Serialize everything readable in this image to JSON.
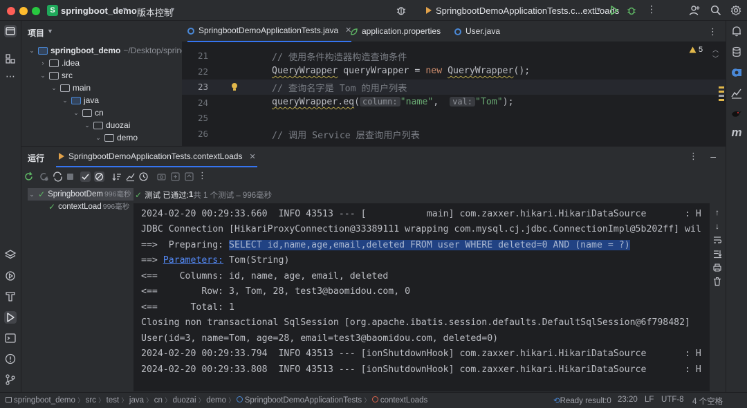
{
  "titlebar": {
    "project_badge": "S",
    "project_name": "springboot_demo",
    "vcs_label": "版本控制",
    "run_config": "SpringbootDemoApplicationTests.c...extLoads"
  },
  "project": {
    "header": "项目",
    "tree": [
      {
        "label": "springboot_demo",
        "path": "~/Desktop/springboot_demo",
        "level": 0,
        "bold": true
      },
      {
        "label": ".idea",
        "level": 1
      },
      {
        "label": "src",
        "level": 1
      },
      {
        "label": "main",
        "level": 2
      },
      {
        "label": "java",
        "level": 3
      },
      {
        "label": "cn",
        "level": 4
      },
      {
        "label": "duozai",
        "level": 5
      },
      {
        "label": "demo",
        "level": 6
      }
    ]
  },
  "editor": {
    "tabs": [
      {
        "label": "SpringbootDemoApplicationTests.java",
        "active": true
      },
      {
        "label": "application.properties",
        "active": false
      },
      {
        "label": "User.java",
        "active": false
      }
    ],
    "warning_count": "5",
    "lines": [
      {
        "num": "21",
        "comment": "// 使用条件构造器构造查询条件"
      },
      {
        "num": "22",
        "type": "QueryWrapper",
        "var": " queryWrapper = ",
        "kw": "new",
        "ctor": "QueryWrapper",
        "end": "();"
      },
      {
        "num": "23",
        "comment": "// 查询名字是 Tom 的用户列表"
      },
      {
        "num": "24",
        "call": "queryWrapper.eq",
        "open": "(",
        "hint1": "column:",
        "arg1": "\"name\"",
        "comma": ",  ",
        "hint2": "val:",
        "arg2": "\"Tom\"",
        "end": ");"
      },
      {
        "num": "25"
      },
      {
        "num": "26",
        "comment": "// 调用 Service 层查询用户列表"
      }
    ]
  },
  "run": {
    "title": "运行",
    "tab_label": "SpringbootDemoApplicationTests.contextLoads",
    "tree": [
      {
        "label": "SpringbootDem",
        "time": "996毫秒"
      },
      {
        "label": "contextLoad",
        "time": "996毫秒"
      }
    ],
    "status": {
      "prefix": "测试 已通过: ",
      "count": "1",
      "rest": "共 1 个测试 – 996毫秒"
    },
    "console": [
      "2024-02-20 00:29:33.660  INFO 43513 --- [           main] com.zaxxer.hikari.HikariDataSource       : H",
      "JDBC Connection [HikariProxyConnection@33389111 wrapping com.mysql.cj.jdbc.ConnectionImpl@5b202ff] wil",
      "==>  Preparing: ",
      "==> ",
      "<==    Columns: id, name, age, email, deleted",
      "<==        Row: 3, Tom, 28, test3@baomidou.com, 0",
      "<==      Total: 1",
      "Closing non transactional SqlSession [org.apache.ibatis.session.defaults.DefaultSqlSession@6f798482]",
      "User(id=3, name=Tom, age=28, email=test3@baomidou.com, deleted=0)",
      "2024-02-20 00:29:33.794  INFO 43513 --- [ionShutdownHook] com.zaxxer.hikari.HikariDataSource       : H",
      "2024-02-20 00:29:33.808  INFO 43513 --- [ionShutdownHook] com.zaxxer.hikari.HikariDataSource       : H"
    ],
    "sql": "SELECT id,name,age,email,deleted FROM user WHERE deleted=0 AND (name = ?)",
    "params_link": "Parameters:",
    "params_value": " Tom(String)"
  },
  "statusbar": {
    "crumbs": [
      "springboot_demo",
      "src",
      "test",
      "java",
      "cn",
      "duozai",
      "demo",
      "SpringbootDemoApplicationTests",
      "contextLoads"
    ],
    "ready": "Ready result:0",
    "position": "23:20",
    "line_sep": "LF",
    "encoding": "UTF-8",
    "indent": "4 个空格"
  },
  "colors": {
    "accent": "#3574f0",
    "pass_green": "#5fb865",
    "selection": "#214283",
    "warning": "#e2b84a"
  }
}
